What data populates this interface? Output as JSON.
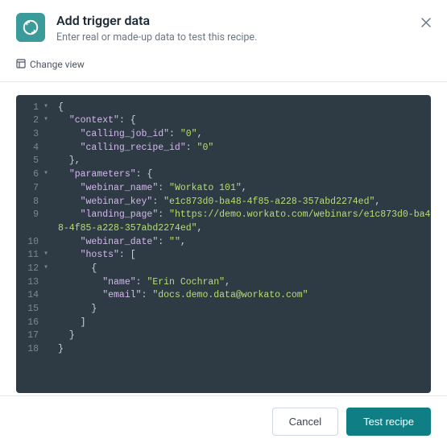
{
  "header": {
    "title": "Add trigger data",
    "subtitle": "Enter real or made-up data to test this recipe."
  },
  "toolbar": {
    "change_view_label": "Change view"
  },
  "code": {
    "lines": [
      {
        "num": 1,
        "fold": "▾",
        "indent": 0,
        "tokens": [
          {
            "t": "punc",
            "v": "{"
          }
        ]
      },
      {
        "num": 2,
        "fold": "▾",
        "indent": 1,
        "tokens": [
          {
            "t": "key",
            "v": "\"context\""
          },
          {
            "t": "punc",
            "v": ": {"
          }
        ]
      },
      {
        "num": 3,
        "fold": "",
        "indent": 2,
        "tokens": [
          {
            "t": "key",
            "v": "\"calling_job_id\""
          },
          {
            "t": "punc",
            "v": ": "
          },
          {
            "t": "str",
            "v": "\"0\""
          },
          {
            "t": "punc",
            "v": ","
          }
        ]
      },
      {
        "num": 4,
        "fold": "",
        "indent": 2,
        "tokens": [
          {
            "t": "key",
            "v": "\"calling_recipe_id\""
          },
          {
            "t": "punc",
            "v": ": "
          },
          {
            "t": "str",
            "v": "\"0\""
          }
        ]
      },
      {
        "num": 5,
        "fold": "",
        "indent": 1,
        "tokens": [
          {
            "t": "punc",
            "v": "},"
          }
        ]
      },
      {
        "num": 6,
        "fold": "▾",
        "indent": 1,
        "tokens": [
          {
            "t": "key",
            "v": "\"parameters\""
          },
          {
            "t": "punc",
            "v": ": {"
          }
        ]
      },
      {
        "num": 7,
        "fold": "",
        "indent": 2,
        "tokens": [
          {
            "t": "key",
            "v": "\"webinar_name\""
          },
          {
            "t": "punc",
            "v": ": "
          },
          {
            "t": "str",
            "v": "\"Workato 101\""
          },
          {
            "t": "punc",
            "v": ","
          }
        ]
      },
      {
        "num": 8,
        "fold": "",
        "indent": 2,
        "tokens": [
          {
            "t": "key",
            "v": "\"webinar_key\""
          },
          {
            "t": "punc",
            "v": ": "
          },
          {
            "t": "str",
            "v": "\"e1c873d0-ba48-4f85-a228-357abd2274ed\""
          },
          {
            "t": "punc",
            "v": ","
          }
        ]
      },
      {
        "num": 9,
        "fold": "",
        "indent": 2,
        "tokens": [
          {
            "t": "key",
            "v": "\"landing_page\""
          },
          {
            "t": "punc",
            "v": ": "
          },
          {
            "t": "str",
            "v": "\"https://demo.workato.com/webinars/e1c873d0-ba48-4f85-a228-357abd2274ed\""
          },
          {
            "t": "punc",
            "v": ","
          }
        ]
      },
      {
        "num": 10,
        "fold": "",
        "indent": 2,
        "tokens": [
          {
            "t": "key",
            "v": "\"webinar_date\""
          },
          {
            "t": "punc",
            "v": ": "
          },
          {
            "t": "str",
            "v": "\"\""
          },
          {
            "t": "punc",
            "v": ","
          }
        ]
      },
      {
        "num": 11,
        "fold": "▾",
        "indent": 2,
        "tokens": [
          {
            "t": "key",
            "v": "\"hosts\""
          },
          {
            "t": "punc",
            "v": ": ["
          }
        ]
      },
      {
        "num": 12,
        "fold": "▾",
        "indent": 3,
        "tokens": [
          {
            "t": "punc",
            "v": "{"
          }
        ]
      },
      {
        "num": 13,
        "fold": "",
        "indent": 4,
        "tokens": [
          {
            "t": "key",
            "v": "\"name\""
          },
          {
            "t": "punc",
            "v": ": "
          },
          {
            "t": "str",
            "v": "\"Erin Cochran\""
          },
          {
            "t": "punc",
            "v": ","
          }
        ]
      },
      {
        "num": 14,
        "fold": "",
        "indent": 4,
        "tokens": [
          {
            "t": "key",
            "v": "\"email\""
          },
          {
            "t": "punc",
            "v": ": "
          },
          {
            "t": "str",
            "v": "\"docs.demo.data@workato.com\""
          }
        ]
      },
      {
        "num": 15,
        "fold": "",
        "indent": 3,
        "tokens": [
          {
            "t": "punc",
            "v": "}"
          }
        ]
      },
      {
        "num": 16,
        "fold": "",
        "indent": 2,
        "tokens": [
          {
            "t": "punc",
            "v": "]"
          }
        ]
      },
      {
        "num": 17,
        "fold": "",
        "indent": 1,
        "tokens": [
          {
            "t": "punc",
            "v": "}"
          }
        ]
      },
      {
        "num": 18,
        "fold": "",
        "indent": 0,
        "tokens": [
          {
            "t": "punc",
            "v": "}"
          }
        ]
      }
    ]
  },
  "footer": {
    "cancel_label": "Cancel",
    "test_label": "Test recipe"
  }
}
